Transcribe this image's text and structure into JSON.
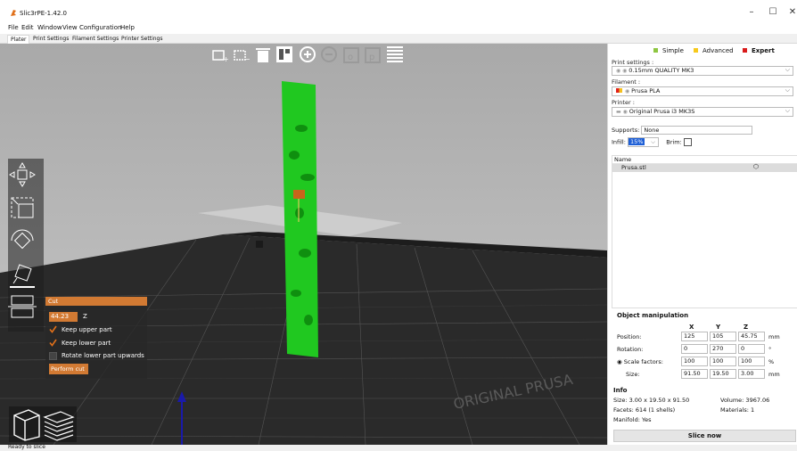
{
  "window": {
    "title": "Slic3rPE-1.42.0"
  },
  "menu": [
    "File",
    "Edit",
    "Window",
    "View",
    "Configuration",
    "Help"
  ],
  "tabs": [
    "Plater",
    "Print Settings",
    "Filament Settings",
    "Printer Settings"
  ],
  "bed_label": "ORIGINAL PRUSA",
  "cut_panel": {
    "title": "Cut",
    "z_value": "44.23",
    "axis": "Z",
    "keep_upper": "Keep upper part",
    "keep_lower": "Keep lower part",
    "rotate_lower": "Rotate lower part upwards",
    "perform": "Perform cut"
  },
  "status": "Ready to slice",
  "sidebar": {
    "modes": [
      "Simple",
      "Advanced",
      "Expert"
    ],
    "mode_colors": [
      "#8ec641",
      "#f7c91c",
      "#d91b1b"
    ],
    "print_settings_label": "Print settings :",
    "print_settings_value": "0.15mm QUALITY MK3",
    "filament_label": "Filament :",
    "filament_value": "Prusa PLA",
    "printer_label": "Printer :",
    "printer_value": "Original Prusa i3 MK3S",
    "supports_label": "Supports:",
    "supports_value": "None",
    "infill_label": "Infill:",
    "infill_value": "15%",
    "brim_label": "Brim:",
    "list_header": "Name",
    "object_name": "Prusa.stl"
  },
  "object_manipulation": {
    "title": "Object manipulation",
    "axes": [
      "X",
      "Y",
      "Z"
    ],
    "position_label": "Position:",
    "position": [
      "125",
      "105",
      "45.75"
    ],
    "position_unit": "mm",
    "rotation_label": "Rotation:",
    "rotation": [
      "0",
      "270",
      "0"
    ],
    "rotation_unit": "°",
    "scale_label": "Scale factors:",
    "scale": [
      "100",
      "100",
      "100"
    ],
    "scale_unit": "%",
    "size_label": "Size:",
    "size": [
      "91.50",
      "19.50",
      "3.00"
    ],
    "size_unit": "mm"
  },
  "info": {
    "title": "Info",
    "size": "Size:   3.00 x 19.50 x 91.50",
    "volume": "Volume:   3967.06",
    "facets": "Facets: 614 (1 shells)",
    "materials": "Materials: 1",
    "manifold": "Manifold: Yes"
  },
  "slice_button": "Slice now",
  "accent": "#d27a33",
  "model_color": "#1ec81e"
}
